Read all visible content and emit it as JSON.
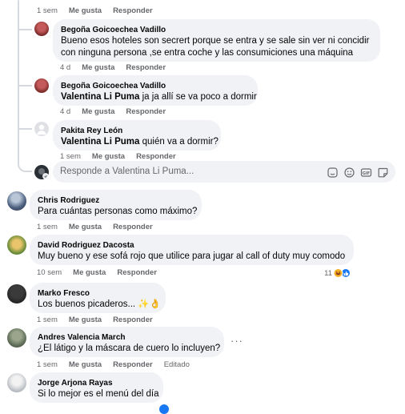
{
  "top_meta": {
    "time": "1 sem",
    "like": "Me gusta",
    "reply": "Responder"
  },
  "replies": [
    {
      "author": "Begoña Goicoechea Vadillo",
      "mention": "",
      "text_line1": "Bueno esos hoteles son secrert porque se entra y se sale sin ver ni concidir",
      "text_line2": "con ninguna persona ,se entra coche y las consumiciones una máquina",
      "time": "4 d",
      "like": "Me gusta",
      "reply": "Responder"
    },
    {
      "author": "Begoña Goicoechea Vadillo",
      "mention": "Valentina Li Puma",
      "text": "ja ja allí se va poco a dormir",
      "time": "4 d",
      "like": "Me gusta",
      "reply": "Responder"
    },
    {
      "author": "Pakita Rey León",
      "mention": "Valentina Li Puma",
      "text": "quién va a dormir?",
      "time": "1 sem",
      "like": "Me gusta",
      "reply": "Responder"
    }
  ],
  "reply_box": {
    "placeholder": "Responde a Valentina Li Puma..."
  },
  "comments": [
    {
      "author": "Chris Rodriguez",
      "text": "Para cuántas personas como máximo?",
      "time": "1 sem",
      "like": "Me gusta",
      "reply": "Responder"
    },
    {
      "author": "David Rodriguez Dacosta",
      "text": "Muy bueno y ese sofá rojo que utilice para jugar al call of duty muy comodo",
      "time": "10 sem",
      "like": "Me gusta",
      "reply": "Responder",
      "reaction_count": "11"
    },
    {
      "author": "Marko Fresco",
      "text": "Los buenos picaderos... ✨👌",
      "time": "1 sem",
      "like": "Me gusta",
      "reply": "Responder"
    },
    {
      "author": "Andres Valencia March",
      "text": "¿El látigo y la máscara de cuero lo incluyen?",
      "time": "1 sem",
      "like": "Me gusta",
      "reply": "Responder",
      "edited": "Editado"
    },
    {
      "author": "Jorge Arjona Rayas",
      "text": "Si lo mejor es el menú del día"
    }
  ],
  "colors": {
    "bubble": "#f0f2f5",
    "meta": "#65676b",
    "like_blue": "#1877f2",
    "haha_yellow": "#f7b125"
  }
}
